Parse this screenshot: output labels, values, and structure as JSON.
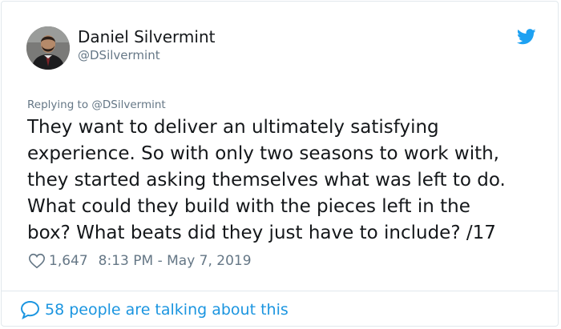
{
  "author": {
    "name": "Daniel Silvermint",
    "handle": "@DSilvermint"
  },
  "icons": {
    "brand": "twitter-bird-icon",
    "like": "heart-outline-icon",
    "conversation": "speech-bubble-icon"
  },
  "colors": {
    "accent": "#1da1f2",
    "link": "#1b95e0",
    "muted": "#657786",
    "text": "#14171a",
    "border": "#e1e8ed"
  },
  "tweet": {
    "replying_to": "Replying to @DSilvermint",
    "lines": [
      "They want to deliver an ultimately satisfying",
      "experience. So with only two seasons to work with,",
      "they started asking themselves what was left to do.",
      "What could they build with the pieces left in the",
      "box? What beats did they just have to include?  /17"
    ],
    "likes": "1,647",
    "timestamp": "8:13 PM - May 7, 2019"
  },
  "footer": {
    "talking_text": "58 people are talking about this"
  }
}
